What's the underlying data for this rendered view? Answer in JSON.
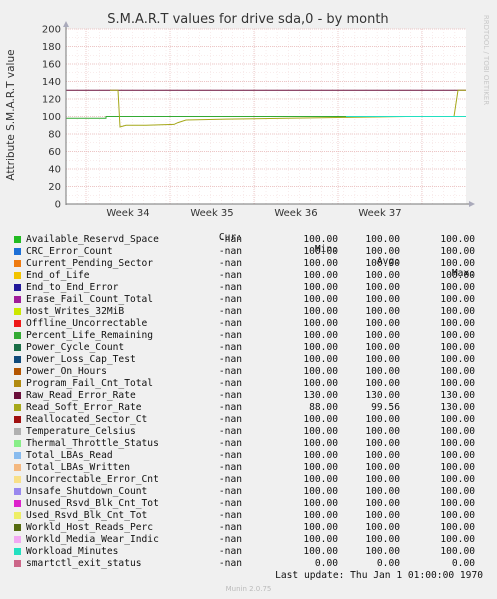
{
  "chart_data": {
    "type": "line",
    "title": "S.M.A.R.T values for drive sda,0 - by month",
    "ylabel": "Attribute S.M.A.R.T value",
    "ylim": [
      0,
      200
    ],
    "yticks": [
      0,
      20,
      40,
      60,
      80,
      100,
      120,
      140,
      160,
      180,
      200
    ],
    "xtick_labels": [
      "Week 34",
      "Week 35",
      "Week 36",
      "Week 37"
    ],
    "side_label": "RRDTOOL / TOBI OETIKER",
    "series_colors": {
      "Raw_Read_Error_Rate": "#6a0f3a",
      "Read_Soft_Error_Rate": "#a6a81a",
      "Percent_Life_Remaining": "#33aa33",
      "Workload_Minutes": "#22e0c0",
      "smartctl_exit_status": "#cc3377"
    },
    "lines": [
      {
        "name": "Raw_Read_Error_Rate",
        "points": [
          [
            0,
            130
          ],
          [
            1,
            130
          ]
        ]
      },
      {
        "name": "Percent_Life_Remaining",
        "points": [
          [
            0,
            98
          ],
          [
            0.1,
            98
          ],
          [
            0.1,
            100
          ],
          [
            0.7,
            100
          ],
          [
            0.7,
            100
          ],
          [
            1,
            100
          ]
        ]
      },
      {
        "name": "Read_Soft_Error_Rate",
        "points": [
          [
            0.11,
            130
          ],
          [
            0.13,
            130
          ],
          [
            0.135,
            88
          ],
          [
            0.15,
            90
          ],
          [
            0.2,
            90
          ],
          [
            0.27,
            91
          ],
          [
            0.28,
            93
          ],
          [
            0.3,
            96
          ],
          [
            0.4,
            97
          ],
          [
            0.55,
            98
          ],
          [
            0.7,
            99
          ],
          [
            0.85,
            100
          ],
          [
            0.97,
            100
          ],
          [
            0.98,
            130
          ],
          [
            1,
            130
          ]
        ]
      },
      {
        "name": "Workload_Minutes",
        "points": [
          [
            0.7,
            100
          ],
          [
            1,
            100
          ]
        ]
      },
      {
        "name": "smartctl_exit_status",
        "points": [
          [
            0,
            0
          ],
          [
            1,
            0
          ]
        ]
      }
    ]
  },
  "legend": {
    "headers": {
      "cur": "Cur:",
      "min": "Min:",
      "avg": "Avg:",
      "max": "Max:"
    },
    "rows": [
      {
        "name": "Available_Reservd_Space",
        "color": "#22bb22",
        "cur": "-nan",
        "min": "100.00",
        "avg": "100.00",
        "max": "100.00"
      },
      {
        "name": "CRC_Error_Count",
        "color": "#1c6fd6",
        "cur": "-nan",
        "min": "100.00",
        "avg": "100.00",
        "max": "100.00"
      },
      {
        "name": "Current_Pending_Sector",
        "color": "#ee7a10",
        "cur": "-nan",
        "min": "100.00",
        "avg": "100.00",
        "max": "100.00"
      },
      {
        "name": "End_of_Life",
        "color": "#f2c400",
        "cur": "-nan",
        "min": "100.00",
        "avg": "100.00",
        "max": "100.00"
      },
      {
        "name": "End_to_End_Error",
        "color": "#22189a",
        "cur": "-nan",
        "min": "100.00",
        "avg": "100.00",
        "max": "100.00"
      },
      {
        "name": "Erase_Fail_Count_Total",
        "color": "#a01c9a",
        "cur": "-nan",
        "min": "100.00",
        "avg": "100.00",
        "max": "100.00"
      },
      {
        "name": "Host_Writes_32MiB",
        "color": "#cce800",
        "cur": "-nan",
        "min": "100.00",
        "avg": "100.00",
        "max": "100.00"
      },
      {
        "name": "Offline_Uncorrectable",
        "color": "#ee1818",
        "cur": "-nan",
        "min": "100.00",
        "avg": "100.00",
        "max": "100.00"
      },
      {
        "name": "Percent_Life_Remaining",
        "color": "#33aa33",
        "cur": "-nan",
        "min": "100.00",
        "avg": "100.00",
        "max": "100.00"
      },
      {
        "name": "Power_Cycle_Count",
        "color": "#1a6e46",
        "cur": "-nan",
        "min": "100.00",
        "avg": "100.00",
        "max": "100.00"
      },
      {
        "name": "Power_Loss_Cap_Test",
        "color": "#114a7a",
        "cur": "-nan",
        "min": "100.00",
        "avg": "100.00",
        "max": "100.00"
      },
      {
        "name": "Power_On_Hours",
        "color": "#b35500",
        "cur": "-nan",
        "min": "100.00",
        "avg": "100.00",
        "max": "100.00"
      },
      {
        "name": "Program_Fail_Cnt_Total",
        "color": "#b08a10",
        "cur": "-nan",
        "min": "100.00",
        "avg": "100.00",
        "max": "100.00"
      },
      {
        "name": "Raw_Read_Error_Rate",
        "color": "#6a0f3a",
        "cur": "-nan",
        "min": "130.00",
        "avg": "130.00",
        "max": "130.00"
      },
      {
        "name": "Read_Soft_Error_Rate",
        "color": "#a6a81a",
        "cur": "-nan",
        "min": "88.00",
        "avg": "99.56",
        "max": "130.00"
      },
      {
        "name": "Reallocated_Sector_Ct",
        "color": "#a01010",
        "cur": "-nan",
        "min": "100.00",
        "avg": "100.00",
        "max": "100.00"
      },
      {
        "name": "Temperature_Celsius",
        "color": "#b0b0b0",
        "cur": "-nan",
        "min": "100.00",
        "avg": "100.00",
        "max": "100.00"
      },
      {
        "name": "Thermal_Throttle_Status",
        "color": "#88ee88",
        "cur": "-nan",
        "min": "100.00",
        "avg": "100.00",
        "max": "100.00"
      },
      {
        "name": "Total_LBAs_Read",
        "color": "#88bbee",
        "cur": "-nan",
        "min": "100.00",
        "avg": "100.00",
        "max": "100.00"
      },
      {
        "name": "Total_LBAs_Written",
        "color": "#f4b880",
        "cur": "-nan",
        "min": "100.00",
        "avg": "100.00",
        "max": "100.00"
      },
      {
        "name": "Uncorrectable_Error_Cnt",
        "color": "#f8e088",
        "cur": "-nan",
        "min": "100.00",
        "avg": "100.00",
        "max": "100.00"
      },
      {
        "name": "Unsafe_Shutdown_Count",
        "color": "#9988ee",
        "cur": "-nan",
        "min": "100.00",
        "avg": "100.00",
        "max": "100.00"
      },
      {
        "name": "Unused_Rsvd_Blk_Cnt_Tot",
        "color": "#dd22cc",
        "cur": "-nan",
        "min": "100.00",
        "avg": "100.00",
        "max": "100.00"
      },
      {
        "name": "Used_Rsvd_Blk_Cnt_Tot",
        "color": "#eeee66",
        "cur": "-nan",
        "min": "100.00",
        "avg": "100.00",
        "max": "100.00"
      },
      {
        "name": "Workld_Host_Reads_Perc",
        "color": "#556b10",
        "cur": "-nan",
        "min": "100.00",
        "avg": "100.00",
        "max": "100.00"
      },
      {
        "name": "Workld_Media_Wear_Indic",
        "color": "#f2a8f2",
        "cur": "-nan",
        "min": "100.00",
        "avg": "100.00",
        "max": "100.00"
      },
      {
        "name": "Workload_Minutes",
        "color": "#22e0c0",
        "cur": "-nan",
        "min": "100.00",
        "avg": "100.00",
        "max": "100.00"
      },
      {
        "name": "smartctl_exit_status",
        "color": "#cc6688",
        "cur": "-nan",
        "min": "0.00",
        "avg": "0.00",
        "max": "0.00"
      }
    ]
  },
  "footer": {
    "last_update": "Last update: Thu Jan  1 01:00:00 1970",
    "munin": "Munin 2.0.75"
  }
}
